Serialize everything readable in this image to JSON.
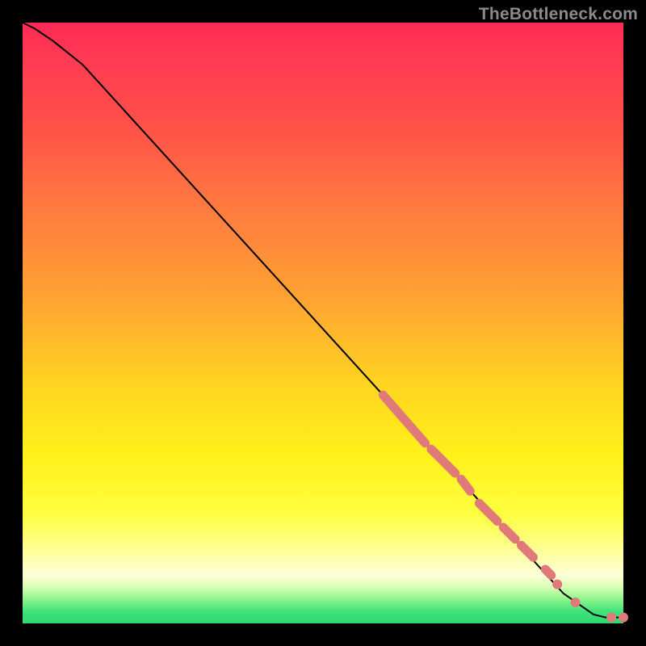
{
  "watermark": "TheBottleneck.com",
  "colors": {
    "background": "#000000",
    "curve": "#000000",
    "dots": "#e07a7a",
    "gradient_top": "#ff2a55",
    "gradient_mid": "#ffd321",
    "gradient_bottom": "#2fd66f"
  },
  "chart_data": {
    "type": "line",
    "title": "",
    "xlabel": "",
    "ylabel": "",
    "xlim": [
      0,
      100
    ],
    "ylim": [
      0,
      100
    ],
    "curve": {
      "x": [
        0,
        2,
        5,
        10,
        20,
        30,
        40,
        50,
        60,
        70,
        80,
        90,
        95,
        97,
        100
      ],
      "y": [
        100,
        99,
        97,
        93,
        82,
        71,
        60,
        49,
        38,
        27,
        16,
        5,
        1.5,
        1.0,
        1.0
      ]
    },
    "highlight_segments": [
      {
        "x0": 60,
        "y0": 38,
        "x1": 67,
        "y1": 30
      },
      {
        "x0": 68,
        "y0": 29,
        "x1": 72,
        "y1": 25
      },
      {
        "x0": 73,
        "y0": 24,
        "x1": 74.5,
        "y1": 22
      },
      {
        "x0": 76,
        "y0": 20,
        "x1": 79,
        "y1": 17
      },
      {
        "x0": 80,
        "y0": 16,
        "x1": 82,
        "y1": 14
      },
      {
        "x0": 83,
        "y0": 13,
        "x1": 85,
        "y1": 11
      },
      {
        "x0": 87,
        "y0": 9,
        "x1": 88,
        "y1": 8
      }
    ],
    "highlight_points": [
      {
        "x": 89,
        "y": 6.5
      },
      {
        "x": 92,
        "y": 3.5
      },
      {
        "x": 98,
        "y": 1.0
      },
      {
        "x": 100,
        "y": 1.0
      }
    ]
  }
}
